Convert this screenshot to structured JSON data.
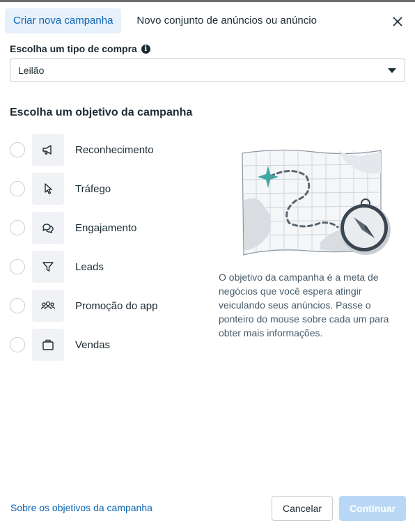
{
  "tabs": [
    {
      "label": "Criar nova campanha",
      "active": true
    },
    {
      "label": "Novo conjunto de anúncios ou anúncio",
      "active": false
    }
  ],
  "purchase_type": {
    "label": "Escolha um tipo de compra",
    "info_icon": "info-icon",
    "selected": "Leilão"
  },
  "objective_section": {
    "title": "Escolha um objetivo da campanha",
    "items": [
      {
        "label": "Reconhecimento",
        "icon": "megaphone-icon"
      },
      {
        "label": "Tráfego",
        "icon": "cursor-icon"
      },
      {
        "label": "Engajamento",
        "icon": "chat-bubbles-icon"
      },
      {
        "label": "Leads",
        "icon": "funnel-icon"
      },
      {
        "label": "Promoção do app",
        "icon": "people-icon"
      },
      {
        "label": "Vendas",
        "icon": "shopping-bag-icon"
      }
    ],
    "description": "O objetivo da campanha é a meta de negócios que você espera atingir veiculando seus anúncios. Passe o ponteiro do mouse sobre cada um para obter mais informações."
  },
  "footer": {
    "link": "Sobre os objetivos da campanha",
    "cancel": "Cancelar",
    "continue": "Continuar"
  },
  "colors": {
    "accent": "#0a64b4",
    "active_tab_bg": "#e7f1fb",
    "continue_disabled_bg": "#b9d8f5",
    "illustration_teal": "#3fa6a2"
  }
}
